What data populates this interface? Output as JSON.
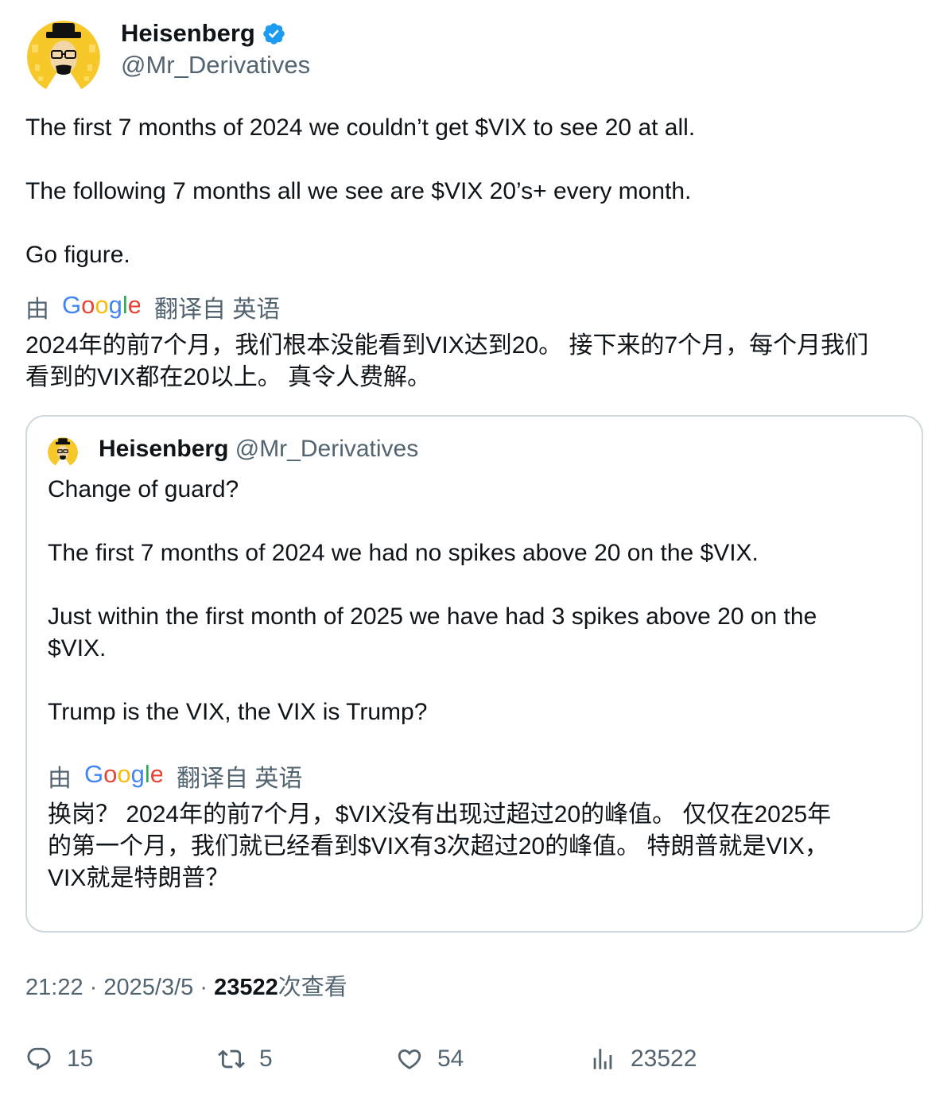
{
  "author": {
    "name": "Heisenberg",
    "handle": "@Mr_Derivatives",
    "verified": true
  },
  "tweet": {
    "paragraphs": [
      "The first 7 months of 2024 we couldn’t get $VIX to see 20 at all.",
      "The following 7 months all we see are $VIX 20’s+ every month.",
      "Go figure."
    ]
  },
  "translation": {
    "by_label": "由",
    "provider": "Google",
    "source_label": "翻译自 英语",
    "text_line1": "2024年的前7个月，我们根本没能看到VIX达到20。 接下来的7个月，每个月我们",
    "text_line2": "看到的VIX都在20以上。 真令人费解。"
  },
  "quote": {
    "name": "Heisenberg",
    "handle": "@Mr_Derivatives",
    "paragraphs": [
      "Change of guard?",
      "The first 7 months of 2024 we had no spikes above 20 on the $VIX.",
      "Just within the first month of 2025 we have had 3 spikes above 20 on the",
      "$VIX.",
      "Trump is the VIX, the VIX is Trump?"
    ],
    "translation": {
      "by_label": "由",
      "provider": "Google",
      "source_label": "翻译自 英语",
      "text_line1": "换岗？ 2024年的前7个月，$VIX没有出现过超过20的峰值。 仅仅在2025年",
      "text_line2": "的第一个月，我们就已经看到$VIX有3次超过20的峰值。 特朗普就是VIX，",
      "text_line3": "VIX就是特朗普？"
    }
  },
  "meta": {
    "time": "21:22",
    "separator": "·",
    "date": "2025/3/5",
    "views_count": "23522",
    "views_label": "次查看"
  },
  "actions": {
    "replies": "15",
    "reposts": "5",
    "likes": "54",
    "views": "23522"
  },
  "colors": {
    "text_primary": "#0f1419",
    "text_secondary": "#536471",
    "verified_blue": "#1d9bf0",
    "border": "#cfd9de",
    "avatar_yellow": "#f7c82a",
    "google_blue": "#4285f4",
    "google_red": "#ea4335",
    "google_yellow": "#fbbc05",
    "google_green": "#34a853"
  },
  "icons": {
    "verified": "verified-badge-icon",
    "reply": "reply-icon",
    "repost": "repost-icon",
    "like": "heart-icon",
    "views": "analytics-icon"
  }
}
